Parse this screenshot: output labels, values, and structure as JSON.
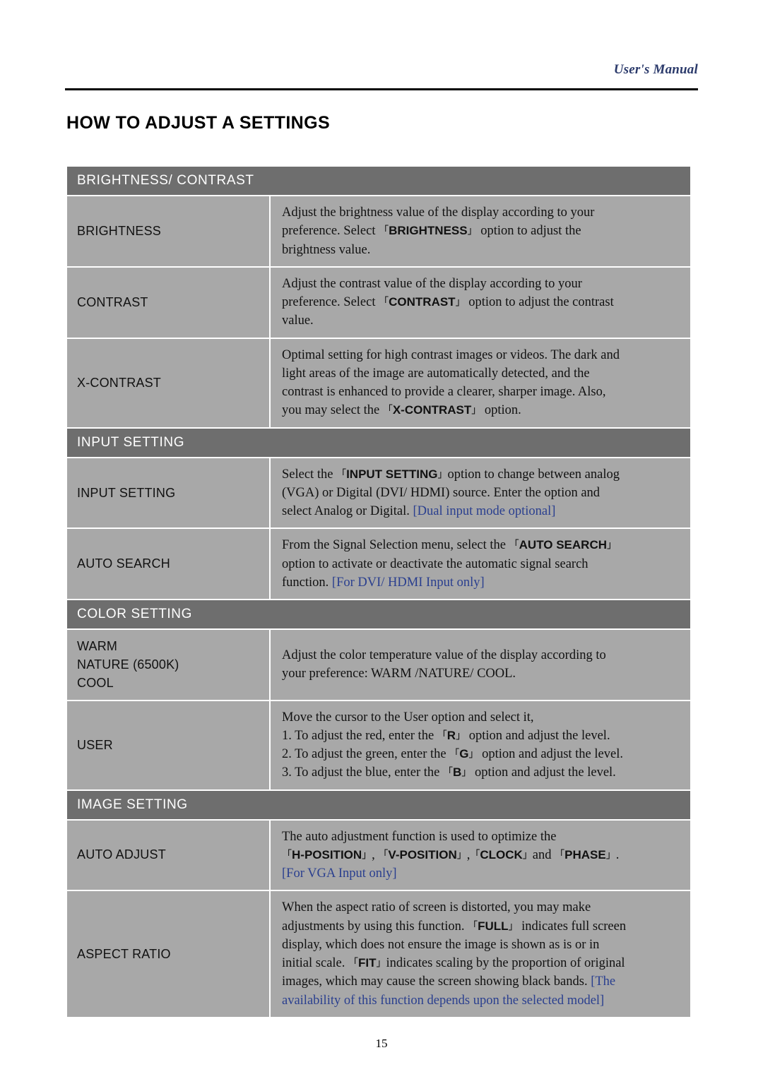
{
  "header": {
    "manual_label": "User's Manual"
  },
  "page_title": "HOW TO ADJUST A SETTINGS",
  "page_number": "15",
  "sections": [
    {
      "heading": "BRIGHTNESS/ CONTRAST",
      "rows": [
        {
          "label": "BRIGHTNESS",
          "desc_line1": "Adjust the brightness value of the display according to your",
          "desc_line2_a": "preference. Select ",
          "desc_line2_term": "BRIGHTNESS",
          "desc_line2_b": " option to adjust the",
          "desc_line3": "brightness value."
        },
        {
          "label": "CONTRAST",
          "desc_line1": "Adjust the contrast value of the display according to your",
          "desc_line2_a": "preference. Select ",
          "desc_line2_term": "CONTRAST",
          "desc_line2_b": " option to adjust the contrast",
          "desc_line3": "value."
        },
        {
          "label": "X-CONTRAST",
          "desc_line1": "Optimal setting for high contrast images or videos. The dark and",
          "desc_line2": "light areas of the image are automatically detected, and the",
          "desc_line3": "contrast is enhanced to provide a clearer, sharper image. Also,",
          "desc_line4_a": "you may select the ",
          "desc_line4_term": "X-CONTRAST",
          "desc_line4_b": " option."
        }
      ]
    },
    {
      "heading": "INPUT SETTING",
      "rows": [
        {
          "label": "INPUT SETTING",
          "desc_line1_a": "Select the ",
          "desc_line1_term": "INPUT SETTING",
          "desc_line1_b": "option to change between analog",
          "desc_line2": "(VGA) or Digital (DVI/ HDMI) source. Enter the option and",
          "desc_line3_a": "select Analog or Digital. ",
          "desc_line3_note": "[Dual input mode optional]"
        },
        {
          "label": "AUTO SEARCH",
          "desc_line1_a": "From the Signal Selection menu, select the  ",
          "desc_line1_term": "AUTO SEARCH",
          "desc_line1_b": "",
          "desc_line2": "option to activate or deactivate the automatic signal search",
          "desc_line3_a": "function. ",
          "desc_line3_note": "[For DVI/ HDMI Input only]"
        }
      ]
    },
    {
      "heading": "COLOR SETTING",
      "rows": [
        {
          "label_lines": [
            "WARM",
            "NATURE (6500K)",
            "COOL"
          ],
          "desc_line1": "Adjust the color temperature value of the display according to",
          "desc_line2": "your preference: WARM /NATURE/ COOL."
        },
        {
          "label": "USER",
          "desc_line1": "Move the cursor to the User option and select it,",
          "desc_line2_a": "1. To adjust the red, enter the ",
          "desc_line2_term": "R",
          "desc_line2_b": " option and adjust the level.",
          "desc_line3_a": "2. To adjust the green, enter the ",
          "desc_line3_term": "G",
          "desc_line3_b": " option and adjust the level.",
          "desc_line4_a": "3. To adjust the blue, enter the ",
          "desc_line4_term": "B",
          "desc_line4_b": " option and adjust the level."
        }
      ]
    },
    {
      "heading": "IMAGE SETTING",
      "rows": [
        {
          "label": "AUTO ADJUST",
          "desc_line1": "The auto adjustment function is used to optimize the",
          "desc_line2_t1": "H-POSITION",
          "desc_line2_t2": "V-POSITION",
          "desc_line2_t3": "CLOCK",
          "desc_line2_and": "and",
          "desc_line2_t4": "PHASE",
          "desc_line3_note": "[For VGA Input only]"
        },
        {
          "label": "ASPECT RATIO",
          "desc_line1": "When the aspect ratio of screen is distorted, you may make",
          "desc_line2_a": "adjustments by using this function. ",
          "desc_line2_term": "FULL",
          "desc_line2_b": " indicates full screen",
          "desc_line3": "display, which does not ensure the image is shown as is or in",
          "desc_line4_a": "initial scale. ",
          "desc_line4_term": "FIT",
          "desc_line4_b": "indicates scaling by the proportion of original",
          "desc_line5_a": "images, which may cause the screen showing black bands. ",
          "desc_line5_note": "[The",
          "desc_line6_note": "availability of this function depends upon the selected model]"
        }
      ]
    }
  ]
}
